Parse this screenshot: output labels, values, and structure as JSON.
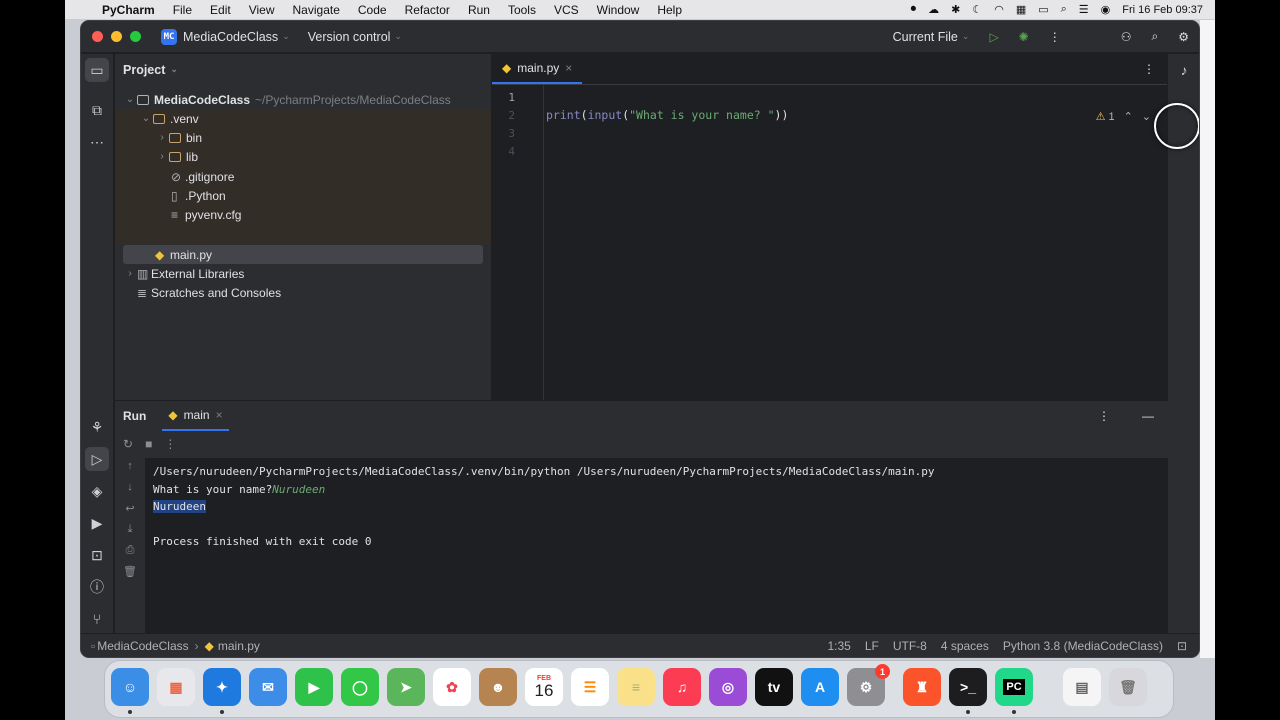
{
  "menubar": {
    "app": "PyCharm",
    "items": [
      "File",
      "Edit",
      "View",
      "Navigate",
      "Code",
      "Refactor",
      "Run",
      "Tools",
      "VCS",
      "Window",
      "Help"
    ],
    "clock": "Fri 16 Feb  09:37"
  },
  "titlebar": {
    "project_badge": "MC",
    "project_name": "MediaCodeClass",
    "vcs": "Version control",
    "run_config": "Current File"
  },
  "project_panel": {
    "title": "Project",
    "tree": [
      {
        "label": "MediaCodeClass",
        "path": "~/PycharmProjects/MediaCodeClass"
      },
      {
        "label": ".venv"
      },
      {
        "label": "bin"
      },
      {
        "label": "lib"
      },
      {
        "label": ".gitignore"
      },
      {
        "label": ".Python"
      },
      {
        "label": "pyvenv.cfg"
      },
      {
        "label": "main.py"
      },
      {
        "label": "External Libraries"
      },
      {
        "label": "Scratches and Consoles"
      }
    ]
  },
  "editor": {
    "tab": "main.py",
    "lines": [
      "1",
      "2",
      "3",
      "4"
    ],
    "code": {
      "fn1": "print",
      "p1": "(",
      "fn2": "input",
      "p2": "(",
      "string": "\"What is your name? \"",
      "close": "))"
    },
    "warnings": "1"
  },
  "run_panel": {
    "title": "Run",
    "tab": "main",
    "console": {
      "command": "/Users/nurudeen/PycharmProjects/MediaCodeClass/.venv/bin/python /Users/nurudeen/PycharmProjects/MediaCodeClass/main.py",
      "prompt": "What is your name?",
      "input": "Nurudeen",
      "output": "Nurudeen",
      "exit": "Process finished with exit code 0"
    }
  },
  "statusbar": {
    "breadcrumb_project": "MediaCodeClass",
    "breadcrumb_file": "main.py",
    "position": "1:35",
    "line_sep": "LF",
    "encoding": "UTF-8",
    "indent": "4 spaces",
    "interpreter": "Python 3.8 (MediaCodeClass)"
  },
  "dock": {
    "calendar_month": "FEB",
    "calendar_day": "16",
    "settings_badge": "1",
    "pycharm_label": "PC"
  },
  "colors": {
    "accent": "#3574f0",
    "ide_bg": "#1e1f22",
    "panel_bg": "#2b2d30",
    "string_green": "#6aab73",
    "builtin_purple": "#8888c6"
  }
}
